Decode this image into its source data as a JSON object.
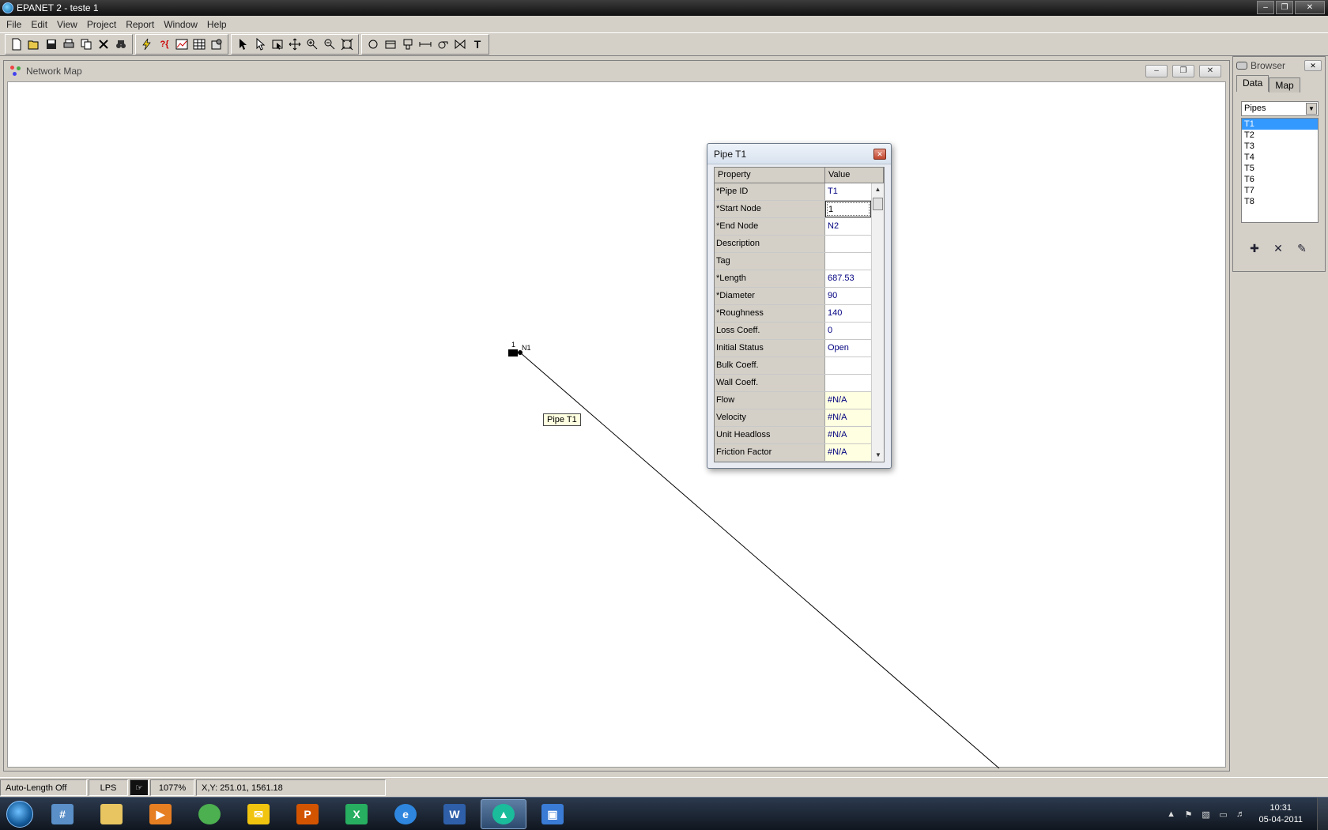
{
  "window": {
    "title": "EPANET 2 - teste 1"
  },
  "menu": [
    "File",
    "Edit",
    "View",
    "Project",
    "Report",
    "Window",
    "Help"
  ],
  "toolbar_icons": [
    "new-icon",
    "open-icon",
    "save-icon",
    "print-icon",
    "copy-icon",
    "delete-icon",
    "find-icon",
    "run-icon",
    "query-icon",
    "graph-icon",
    "table-icon",
    "options-icon",
    "select-object-icon",
    "select-vertex-icon",
    "select-region-icon",
    "pan-icon",
    "zoom-in-icon",
    "zoom-out-icon",
    "full-extent-icon",
    "add-junction-icon",
    "add-reservoir-icon",
    "add-tank-icon",
    "add-pipe-icon",
    "add-pump-icon",
    "add-valve-icon",
    "add-label-icon"
  ],
  "map": {
    "title": "Network Map",
    "node_label": "N1",
    "node_tag": "1",
    "tooltip": "Pipe T1"
  },
  "dialog": {
    "title": "Pipe T1",
    "col_property": "Property",
    "col_value": "Value",
    "rows": [
      {
        "property": "*Pipe ID",
        "value": "T1",
        "type": "normal"
      },
      {
        "property": "*Start Node",
        "value": "1",
        "type": "edit"
      },
      {
        "property": "*End Node",
        "value": "N2",
        "type": "normal"
      },
      {
        "property": "Description",
        "value": "",
        "type": "normal"
      },
      {
        "property": "Tag",
        "value": "",
        "type": "normal"
      },
      {
        "property": "*Length",
        "value": "687.53",
        "type": "normal"
      },
      {
        "property": "*Diameter",
        "value": "90",
        "type": "normal"
      },
      {
        "property": "*Roughness",
        "value": "140",
        "type": "normal"
      },
      {
        "property": "Loss Coeff.",
        "value": "0",
        "type": "normal"
      },
      {
        "property": "Initial Status",
        "value": "Open",
        "type": "normal"
      },
      {
        "property": "Bulk Coeff.",
        "value": "",
        "type": "normal"
      },
      {
        "property": "Wall Coeff.",
        "value": "",
        "type": "normal"
      },
      {
        "property": "Flow",
        "value": "#N/A",
        "type": "readonly"
      },
      {
        "property": "Velocity",
        "value": "#N/A",
        "type": "readonly"
      },
      {
        "property": "Unit Headloss",
        "value": "#N/A",
        "type": "readonly"
      },
      {
        "property": "Friction Factor",
        "value": "#N/A",
        "type": "readonly"
      }
    ]
  },
  "browser": {
    "title": "Browser",
    "tabs": [
      "Data",
      "Map"
    ],
    "selected_category": "Pipes",
    "items": [
      "T1",
      "T2",
      "T3",
      "T4",
      "T5",
      "T6",
      "T7",
      "T8"
    ],
    "selected_item": "T1"
  },
  "status": {
    "auto_length": "Auto-Length Off",
    "units": "LPS",
    "zoom": "1077%",
    "coords": "X,Y: 251.01, 1561.18"
  },
  "taskbar": {
    "time": "10:31",
    "date": "05-04-2011",
    "apps": [
      "calculator-icon",
      "explorer-icon",
      "media-player-icon",
      "messenger-icon",
      "outlook-icon",
      "powerpoint-icon",
      "excel-icon",
      "internet-explorer-icon",
      "word-icon",
      "epanet-icon",
      "remote-desktop-icon"
    ]
  }
}
